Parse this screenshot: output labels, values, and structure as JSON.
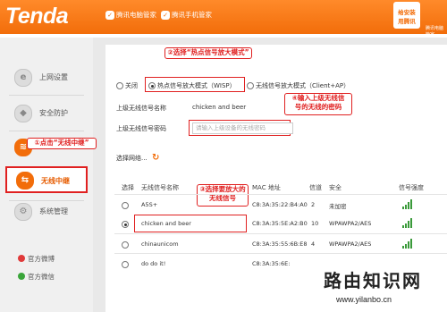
{
  "header": {
    "logo": "Tenda",
    "link1": "腾讯电脑管家",
    "link2": "腾讯手机管家",
    "qr_line1": "给安装",
    "qr_line2": "用腾讯",
    "qr_caption": "腾讯电脑管家"
  },
  "sidebar": {
    "items": [
      {
        "label": "上网设置"
      },
      {
        "label": "安全防护"
      },
      {
        "label": ""
      },
      {
        "label": "无线中继"
      },
      {
        "label": "系统管理"
      }
    ],
    "social": [
      {
        "label": "官方微博"
      },
      {
        "label": "官方微信"
      }
    ]
  },
  "annotations": {
    "step1": "①点击“无线中继”",
    "step2": "②选择“热点信号放大模式”",
    "step3": "③选择要放大的",
    "step3b": "无线信号",
    "step4": "④输入上级无线信",
    "step4b": "号的无线的密码"
  },
  "modes": {
    "off": "关闭",
    "wisp": "热点信号放大模式（WISP）",
    "client": "无线信号放大模式（Client+AP）"
  },
  "form": {
    "ssid_label": "上级无线信号名称",
    "ssid_value": "chicken and beer",
    "pwd_label": "上级无线信号密码",
    "pwd_placeholder": "请输入上级设备的无线密码",
    "scan_label": "选择网络..."
  },
  "table": {
    "headers": [
      "选择",
      "无线信号名称",
      "MAC 地址",
      "信道",
      "安全",
      "信号强度"
    ],
    "rows": [
      {
        "name": "A5S+",
        "mac": "C8:3A:35:22:B4:A0",
        "channel": "2",
        "security": "未加密",
        "selected": false,
        "signal": 4
      },
      {
        "name": "chicken and beer",
        "mac": "C8:3A:35:5E:A2:B0",
        "channel": "10",
        "security": "WPAWPA2/AES",
        "selected": true,
        "signal": 4
      },
      {
        "name": "chinaunicom",
        "mac": "C8:3A:35:55:6B:E8",
        "channel": "4",
        "security": "WPAWPA2/AES",
        "selected": false,
        "signal": 4
      },
      {
        "name": "do do it!",
        "mac": "C8:3A:35:6E:",
        "channel": "",
        "security": "",
        "selected": false,
        "signal": 0
      }
    ]
  },
  "watermark": {
    "title": "路由知识网",
    "url": "www.yilanbo.cn"
  },
  "colors": {
    "brand": "#f26d0a",
    "annotation": "#e02020",
    "signal": "#3a9a3a"
  }
}
